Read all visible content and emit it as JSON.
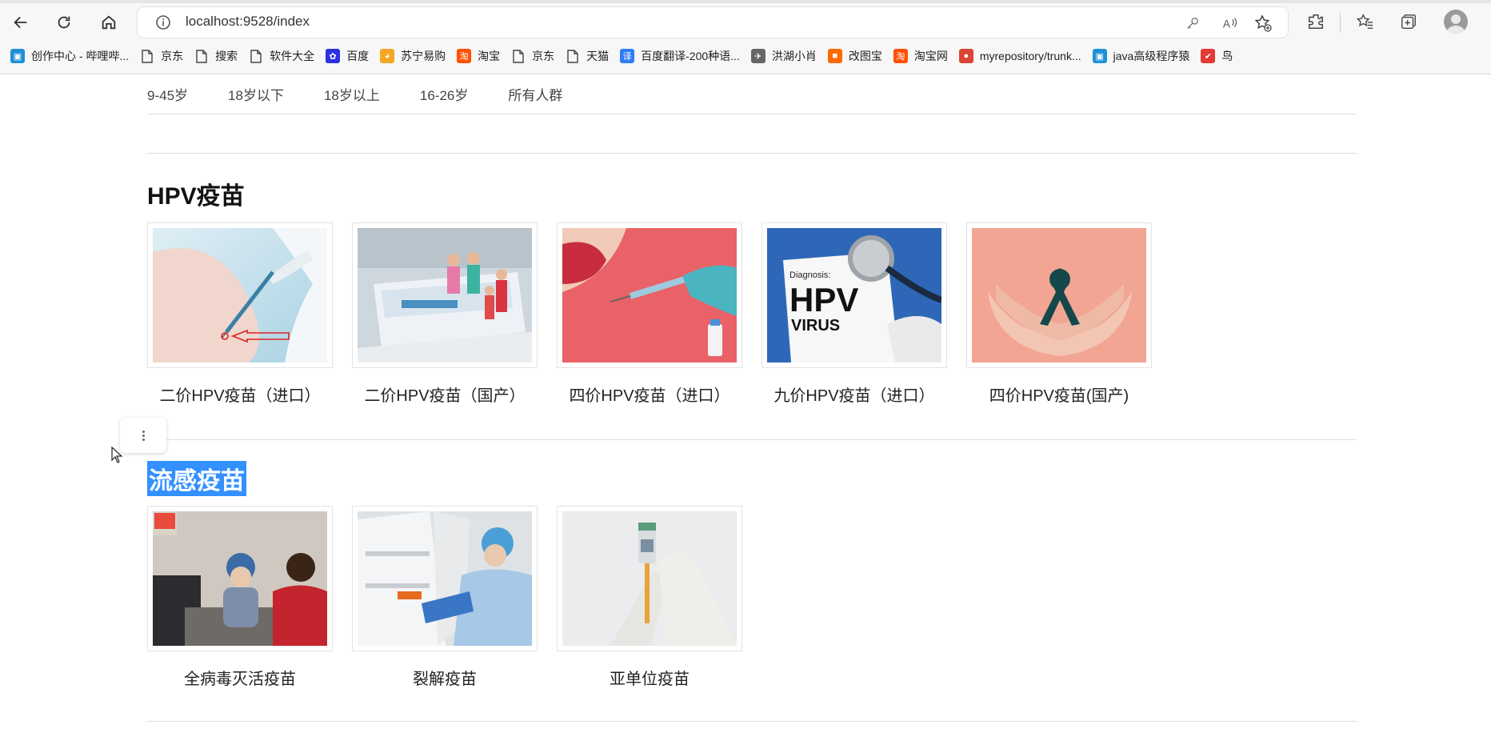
{
  "browser": {
    "url": "localhost:9528/index",
    "bookmarks": [
      {
        "label": "创作中心 - 哔哩哔...",
        "icon": "bilibili-icon",
        "color": "#1e90d8"
      },
      {
        "label": "京东",
        "icon": "page-icon",
        "color": "#555555"
      },
      {
        "label": "搜索",
        "icon": "page-icon",
        "color": "#555555"
      },
      {
        "label": "软件大全",
        "icon": "page-icon",
        "color": "#555555"
      },
      {
        "label": "百度",
        "icon": "baidu-paw-icon",
        "color": "#2932e1"
      },
      {
        "label": "苏宁易购",
        "icon": "suning-icon",
        "color": "#f5a623"
      },
      {
        "label": "淘宝",
        "icon": "taobao-icon",
        "color": "#ff5000"
      },
      {
        "label": "京东",
        "icon": "page-icon",
        "color": "#555555"
      },
      {
        "label": "天猫",
        "icon": "page-icon",
        "color": "#555555"
      },
      {
        "label": "百度翻译-200种语...",
        "icon": "translate-icon",
        "color": "#2e7cf6"
      },
      {
        "label": "洪湖小肖",
        "icon": "bird-icon",
        "color": "#666666"
      },
      {
        "label": "改图宝",
        "icon": "gaitubao-icon",
        "color": "#ff6a00"
      },
      {
        "label": "淘宝网",
        "icon": "taobao-icon",
        "color": "#ff5000"
      },
      {
        "label": "myrepository/trunk...",
        "icon": "chrome-icon",
        "color": "#db4437"
      },
      {
        "label": "java高级程序猿",
        "icon": "bilibili-icon",
        "color": "#1e90d8"
      },
      {
        "label": "鸟",
        "icon": "bird-red-icon",
        "color": "#e53935"
      }
    ]
  },
  "filters": [
    "9-45岁",
    "18岁以下",
    "18岁以上",
    "16-26岁",
    "所有人群"
  ],
  "sections": [
    {
      "title": "HPV疫苗",
      "items": [
        {
          "label": "二价HPV疫苗（进口）",
          "image": "arm-injection-photo"
        },
        {
          "label": "二价HPV疫苗（国产）",
          "image": "vaccine-box-figurines-photo"
        },
        {
          "label": "四价HPV疫苗（进口）",
          "image": "injection-illustration-red"
        },
        {
          "label": "九价HPV疫苗（进口）",
          "image": "hpv-diagnosis-stethoscope-photo"
        },
        {
          "label": "四价HPV疫苗(国产)",
          "image": "ribbon-hands-photo"
        }
      ]
    },
    {
      "title": "流感疫苗",
      "items": [
        {
          "label": "全病毒灭活疫苗",
          "image": "nurse-vaccinating-photo"
        },
        {
          "label": "裂解疫苗",
          "image": "vaccine-fridge-photo"
        },
        {
          "label": "亚单位疫苗",
          "image": "vial-syringe-gloves-photo"
        }
      ]
    }
  ],
  "image_text": {
    "hpv_card": "HPV",
    "hpv_card_sub": "VIRUS",
    "hpv_card_head": "Diagnosis:"
  }
}
